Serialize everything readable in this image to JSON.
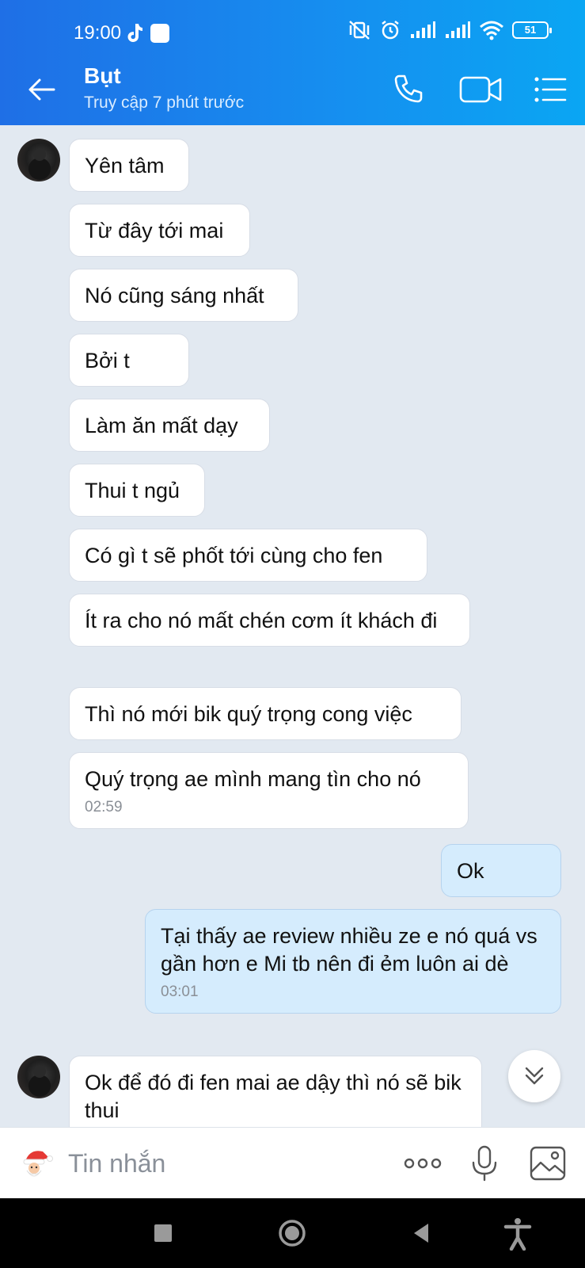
{
  "status_bar": {
    "time": "19:00",
    "battery": "51"
  },
  "header": {
    "name": "Bụt",
    "status": "Truy cập 7 phút trước"
  },
  "messages": [
    {
      "side": "them",
      "text": "Yên tâm",
      "avatar": true
    },
    {
      "side": "them",
      "text": "Từ đây tới mai"
    },
    {
      "side": "them",
      "text": "Nó cũng sáng nhất"
    },
    {
      "side": "them",
      "text": "Bởi t"
    },
    {
      "side": "them",
      "text": "Làm ăn mất dạy"
    },
    {
      "side": "them",
      "text": "Thui t ngủ"
    },
    {
      "side": "them",
      "text": "Có gì t sẽ phốt tới cùng cho fen"
    },
    {
      "side": "them",
      "text": "Ít ra cho nó mất chén cơm ít khách đi"
    },
    {
      "side": "them",
      "text": "Thì nó mới bik quý trọng cong việc"
    },
    {
      "side": "them",
      "text": "Quý trọng ae mình mang tìn cho nó",
      "time": "02:59"
    },
    {
      "side": "me",
      "text": "Ok"
    },
    {
      "side": "me",
      "text": "Tại thấy ae review nhiều ze e nó quá vs gần hơn e Mi tb nên đi ẻm luôn ai dè",
      "time": "03:01"
    },
    {
      "side": "them",
      "text": "Ok để đó đi fen mai ae dậy thì nó sẽ bik thui",
      "avatar": true
    }
  ],
  "composer": {
    "placeholder": "Tin nhắn"
  },
  "icons": {
    "back": "arrow-left-icon",
    "call": "phone-icon",
    "video": "video-camera-icon",
    "menu": "list-menu-icon",
    "sticker": "santa-sticker-icon",
    "more": "more-dots-icon",
    "mic": "microphone-icon",
    "image": "image-gallery-icon",
    "scroll": "chevron-double-down-icon"
  },
  "colors": {
    "header_start": "#1f6fe6",
    "header_end": "#0aa6f3",
    "chat_bg": "#e2e9f1",
    "my_bubble": "#d5ecfd",
    "their_bubble": "#ffffff"
  }
}
